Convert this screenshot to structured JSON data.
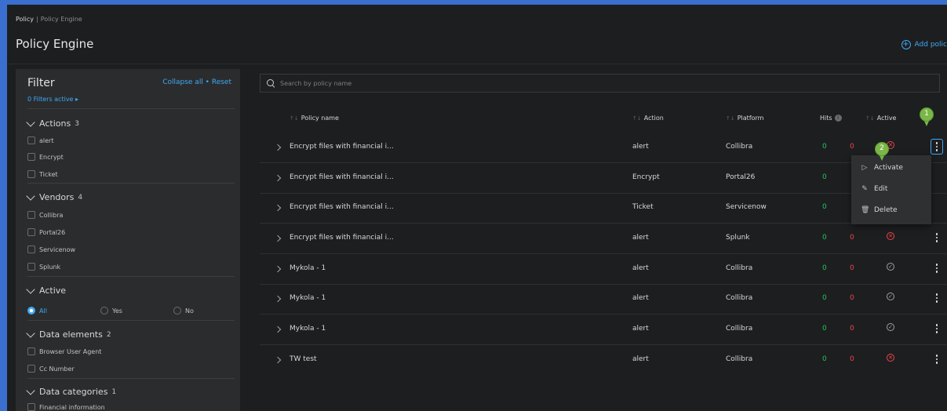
{
  "breadcrumb": {
    "root": "Policy",
    "separator": "|",
    "current": "Policy Engine"
  },
  "page_title": "Policy Engine",
  "add_policy_label": "Add polic",
  "filter": {
    "title": "Filter",
    "links": "Collapse all • Reset",
    "active_label": "0 Filters active ▸",
    "actions": {
      "label": "Actions",
      "count": "3",
      "items": [
        "alert",
        "Encrypt",
        "Ticket"
      ]
    },
    "vendors": {
      "label": "Vendors",
      "count": "4",
      "items": [
        "Collibra",
        "Portal26",
        "Servicenow",
        "Splunk"
      ]
    },
    "active": {
      "label": "Active",
      "options": [
        "All",
        "Yes",
        "No"
      ],
      "selected": "All"
    },
    "data_elements": {
      "label": "Data elements",
      "count": "2",
      "items": [
        "Browser User Agent",
        "Cc Number"
      ]
    },
    "data_categories": {
      "label": "Data categories",
      "count": "1",
      "items": [
        "Financial information"
      ]
    }
  },
  "search": {
    "placeholder": "Search by policy name"
  },
  "table": {
    "headers": {
      "name": "Policy name",
      "action": "Action",
      "platform": "Platform",
      "hits": "Hits",
      "active": "Active",
      "sort_icon": "↑↓",
      "info_icon": "i"
    },
    "rows": [
      {
        "name": "Encrypt files with financial i...",
        "action": "alert",
        "platform": "Collibra",
        "hits_a": "0",
        "hits_b": "0",
        "active": "off"
      },
      {
        "name": "Encrypt files with financial i...",
        "action": "Encrypt",
        "platform": "Portal26",
        "hits_a": "0",
        "hits_b": "",
        "active": ""
      },
      {
        "name": "Encrypt files with financial i...",
        "action": "Ticket",
        "platform": "Servicenow",
        "hits_a": "0",
        "hits_b": "",
        "active": ""
      },
      {
        "name": "Encrypt files with financial i...",
        "action": "alert",
        "platform": "Splunk",
        "hits_a": "0",
        "hits_b": "0",
        "active": "off"
      },
      {
        "name": "Mykola - 1",
        "action": "alert",
        "platform": "Collibra",
        "hits_a": "0",
        "hits_b": "0",
        "active": "on"
      },
      {
        "name": "Mykola - 1",
        "action": "alert",
        "platform": "Collibra",
        "hits_a": "0",
        "hits_b": "0",
        "active": "on"
      },
      {
        "name": "Mykola - 1",
        "action": "alert",
        "platform": "Collibra",
        "hits_a": "0",
        "hits_b": "0",
        "active": "on"
      },
      {
        "name": "TW test",
        "action": "alert",
        "platform": "Collibra",
        "hits_a": "0",
        "hits_b": "0",
        "active": "off"
      }
    ]
  },
  "status_glyphs": {
    "on": "✓",
    "off": "✕"
  },
  "context_menu": {
    "activate": "Activate",
    "edit": "Edit",
    "delete": "Delete",
    "activate_icon": "▷",
    "edit_icon": "✎",
    "delete_icon": "🗑"
  },
  "markers": {
    "one": "1",
    "two": "2"
  },
  "colors": {
    "accent": "#3fa9f5",
    "green": "#22c55e",
    "red": "#ef4444",
    "marker": "#7ab648"
  }
}
